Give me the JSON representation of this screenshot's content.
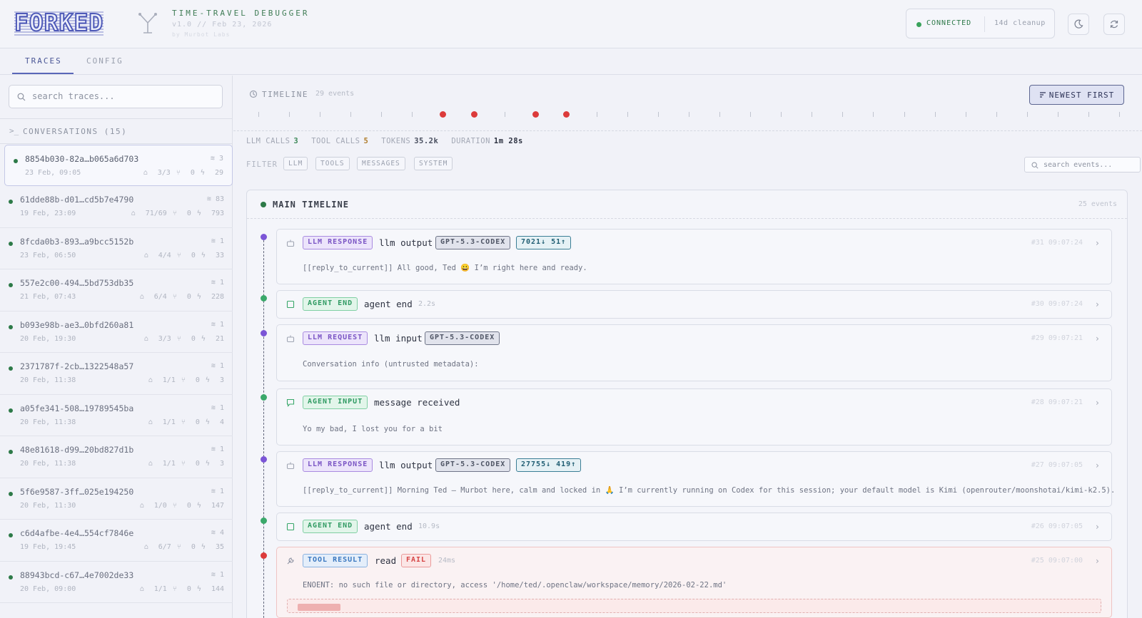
{
  "brand": {
    "logo": "FORKED",
    "title": "TIME-TRAVEL DEBUGGER",
    "version": "v1.0 // Feb 23, 2026",
    "byline": "by Murbot Labs"
  },
  "status": {
    "connection": "CONNECTED",
    "cleanup": "14d cleanup"
  },
  "tabs": [
    {
      "label": "TRACES"
    },
    {
      "label": "CONFIG"
    }
  ],
  "sidebar": {
    "search_placeholder": "search traces...",
    "conversations_label": "CONVERSATIONS (15)",
    "conversations": [
      {
        "id": "8854b030-82a…b065a6d703",
        "date": "23 Feb, 09:05",
        "count": "3",
        "llm": "3/3",
        "forks": "0",
        "events": "29"
      },
      {
        "id": "61dde88b-d01…cd5b7e4790",
        "date": "19 Feb, 23:09",
        "count": "83",
        "llm": "71/69",
        "forks": "0",
        "events": "793"
      },
      {
        "id": "8fcda0b3-893…a9bcc5152b",
        "date": "23 Feb, 06:50",
        "count": "1",
        "llm": "4/4",
        "forks": "0",
        "events": "33"
      },
      {
        "id": "557e2c00-494…5bd753db35",
        "date": "21 Feb, 07:43",
        "count": "1",
        "llm": "6/4",
        "forks": "0",
        "events": "228"
      },
      {
        "id": "b093e98b-ae3…0bfd260a81",
        "date": "20 Feb, 19:30",
        "count": "1",
        "llm": "3/3",
        "forks": "0",
        "events": "21"
      },
      {
        "id": "2371787f-2cb…1322548a57",
        "date": "20 Feb, 11:38",
        "count": "1",
        "llm": "1/1",
        "forks": "0",
        "events": "3"
      },
      {
        "id": "a05fe341-508…19789545ba",
        "date": "20 Feb, 11:38",
        "count": "1",
        "llm": "1/1",
        "forks": "0",
        "events": "4"
      },
      {
        "id": "48e81618-d99…20bd827d1b",
        "date": "20 Feb, 11:38",
        "count": "1",
        "llm": "1/1",
        "forks": "0",
        "events": "3"
      },
      {
        "id": "5f6e9587-3ff…025e194250",
        "date": "20 Feb, 11:30",
        "count": "1",
        "llm": "1/0",
        "forks": "0",
        "events": "147"
      },
      {
        "id": "c6d4afbe-4e4…554cf7846e",
        "date": "19 Feb, 19:45",
        "count": "4",
        "llm": "6/7",
        "forks": "0",
        "events": "35"
      },
      {
        "id": "88943bcd-c67…4e7002de33",
        "date": "20 Feb, 09:00",
        "count": "1",
        "llm": "1/1",
        "forks": "0",
        "events": "144"
      }
    ]
  },
  "timeline": {
    "label": "TIMELINE",
    "events": "29 events",
    "sort_button": "NEWEST FIRST",
    "stats": [
      {
        "key": "LLM CALLS",
        "value": "3",
        "color": "#3f8a5a"
      },
      {
        "key": "TOOL CALLS",
        "value": "5",
        "color": "#b07d2c"
      },
      {
        "key": "TOKENS",
        "value": "35.2k",
        "color": "#4a5060"
      },
      {
        "key": "DURATION",
        "value": "1m 28s",
        "color": "#2e3342"
      }
    ],
    "filter_label": "FILTER",
    "filters": [
      "LLM",
      "TOOLS",
      "MESSAGES",
      "SYSTEM"
    ],
    "search_placeholder": "search events..."
  },
  "panel": {
    "title": "MAIN TIMELINE",
    "count": "25 events",
    "events": [
      {
        "badge": "LLM RESPONSE",
        "title": "llm output",
        "model": "GPT-5.3-CODEX",
        "tokens": "7021↓ 51↑",
        "meta": "#31  09:07:24",
        "body": "[[reply_to_current]] All good, Ted 😀 I’m right here and ready."
      },
      {
        "badge": "AGENT END",
        "title": "agent end",
        "duration": "2.2s",
        "meta": "#30  09:07:24"
      },
      {
        "badge": "LLM REQUEST",
        "title": "llm input",
        "model": "GPT-5.3-CODEX",
        "meta": "#29  09:07:21",
        "body": "Conversation info (untrusted metadata):"
      },
      {
        "badge": "AGENT INPUT",
        "title": "message received",
        "meta": "#28  09:07:21",
        "body": "Yo my bad, I lost you for a bit"
      },
      {
        "badge": "LLM RESPONSE",
        "title": "llm output",
        "model": "GPT-5.3-CODEX",
        "tokens": "27755↓ 419↑",
        "meta": "#27  09:07:05",
        "body": "[[reply_to_current]] Morning Ted — Murbot here, calm and locked in 🙏 I’m currently running on Codex for this session; your default model is Kimi (openrouter/moonshotai/kimi-k2.5)."
      },
      {
        "badge": "AGENT END",
        "title": "agent end",
        "duration": "10.9s",
        "meta": "#26  09:07:05"
      },
      {
        "badge": "TOOL RESULT",
        "title": "read",
        "status": "FAIL",
        "duration": "24ms",
        "meta": "#25  09:07:00",
        "body": "ENOENT: no such file or directory, access '/home/ted/.openclaw/workspace/memory/2026-02-22.md'"
      }
    ]
  },
  "colors": {
    "accent": "#5a67b8",
    "llm": "#7a55c4",
    "agent": "#2f9a62",
    "tool": "#3b78c0",
    "fail": "#d64545",
    "marker": "#dc3b3b"
  }
}
